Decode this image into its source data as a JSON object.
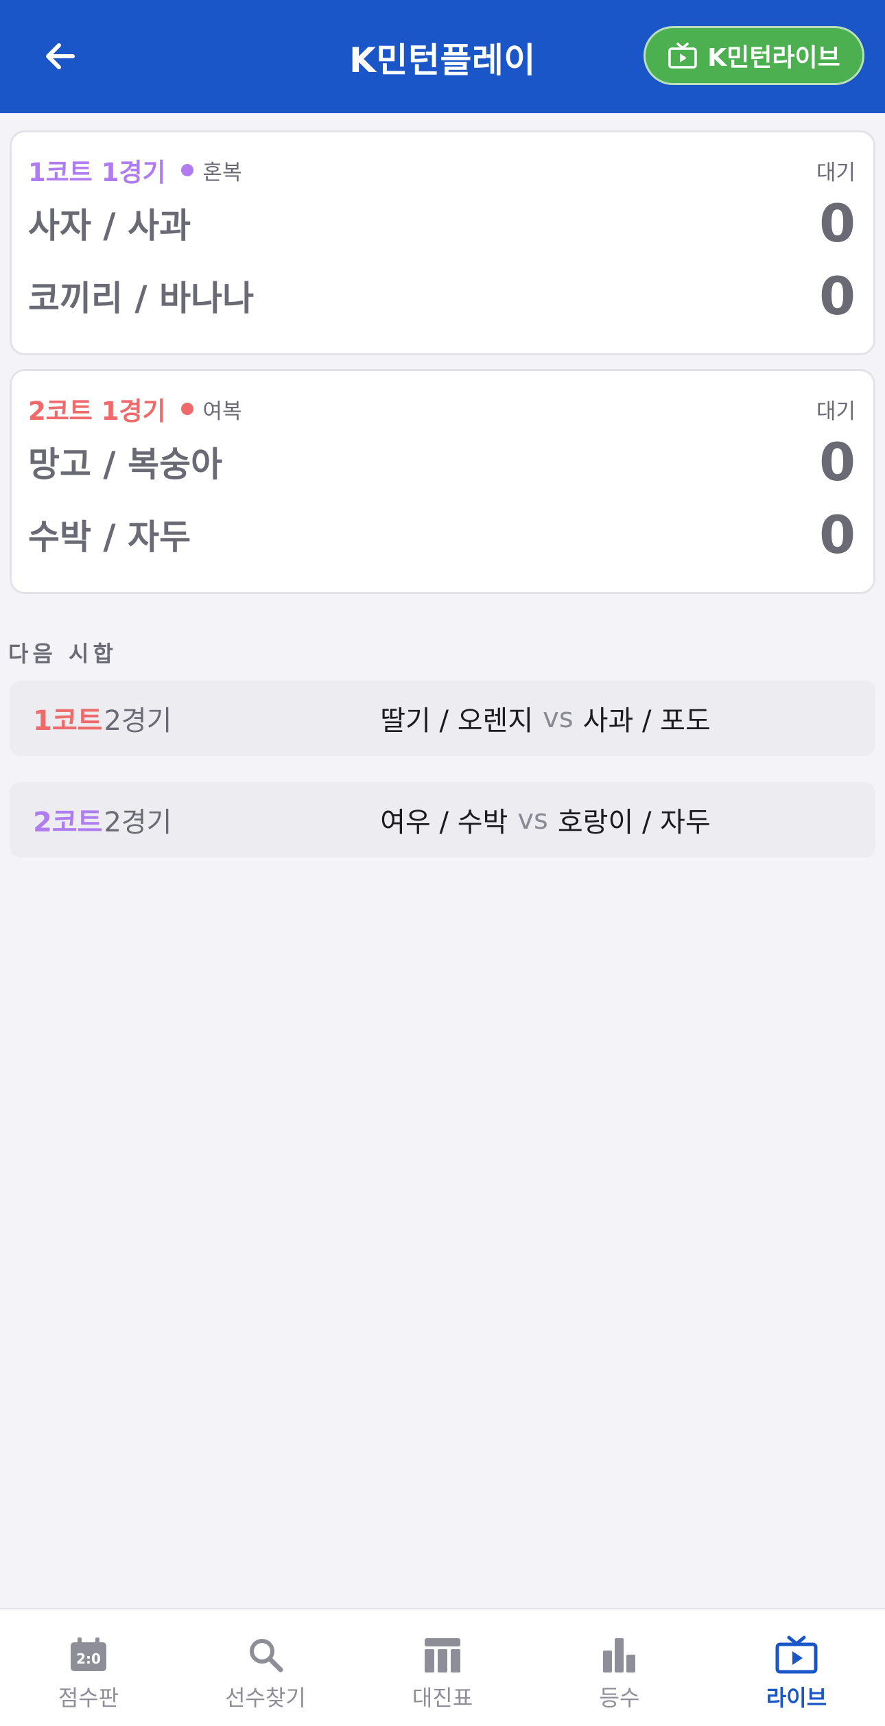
{
  "header": {
    "title": "K민턴플레이",
    "live_button": "K민턴라이브"
  },
  "matches": [
    {
      "court": "1코트 1경기",
      "type": "혼복",
      "status": "대기",
      "teams": [
        {
          "name": "사자 / 사과",
          "score": "0"
        },
        {
          "name": "코끼리 / 바나나",
          "score": "0"
        }
      ]
    },
    {
      "court": "2코트 1경기",
      "type": "여복",
      "status": "대기",
      "teams": [
        {
          "name": "망고 / 복숭아",
          "score": "0"
        },
        {
          "name": "수박 / 자두",
          "score": "0"
        }
      ]
    }
  ],
  "next_section": {
    "label": "다음 시합",
    "items": [
      {
        "court": "1코트",
        "game": "2경기",
        "team_a": "딸기 / 오렌지",
        "vs": "vs",
        "team_b": "사과 / 포도"
      },
      {
        "court": "2코트",
        "game": "2경기",
        "team_a": "여우 / 수박",
        "vs": "vs",
        "team_b": "호랑이 / 자두"
      }
    ]
  },
  "nav": {
    "items": [
      {
        "label": "점수판",
        "icon": "scoreboard-icon"
      },
      {
        "label": "선수찾기",
        "icon": "search-icon"
      },
      {
        "label": "대진표",
        "icon": "bracket-table-icon"
      },
      {
        "label": "등수",
        "icon": "bar-chart-icon"
      },
      {
        "label": "라이브",
        "icon": "live-tv-icon"
      }
    ],
    "active_index": 4
  },
  "colors": {
    "header": "#1a56c8",
    "live_button": "#4caf50",
    "court_purple": "#b07df0",
    "court_red": "#ef6a6a",
    "nav_active": "#1a56c8"
  }
}
